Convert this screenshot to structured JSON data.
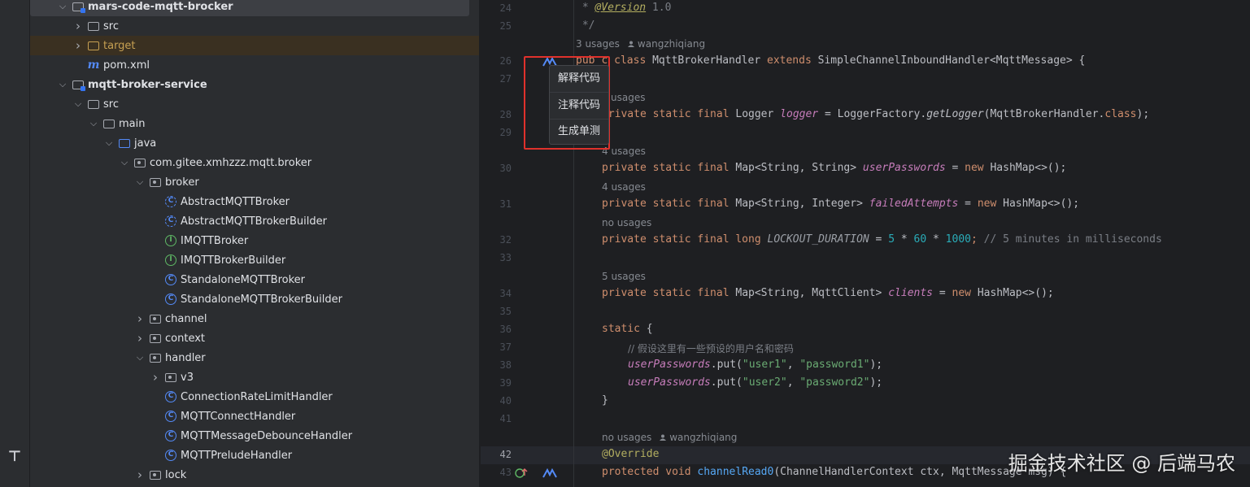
{
  "project_tree": {
    "rows": [
      {
        "label": "mars-code-mqtt-brocker",
        "depth": 2,
        "chevron": "down",
        "icon": "module-folder",
        "selected": true,
        "bold": true
      },
      {
        "label": "src",
        "depth": 3,
        "chevron": "right",
        "icon": "folder"
      },
      {
        "label": "target",
        "depth": 3,
        "chevron": "right",
        "icon": "excluded-folder",
        "excluded": true
      },
      {
        "label": "pom.xml",
        "depth": 3,
        "chevron": "none",
        "icon": "maven"
      },
      {
        "label": "mqtt-broker-service",
        "depth": 2,
        "chevron": "down",
        "icon": "module-folder",
        "bold": true
      },
      {
        "label": "src",
        "depth": 3,
        "chevron": "down",
        "icon": "folder"
      },
      {
        "label": "main",
        "depth": 4,
        "chevron": "down",
        "icon": "folder"
      },
      {
        "label": "java",
        "depth": 5,
        "chevron": "down",
        "icon": "source-root"
      },
      {
        "label": "com.gitee.xmhzzz.mqtt.broker",
        "depth": 6,
        "chevron": "down",
        "icon": "package"
      },
      {
        "label": "broker",
        "depth": 7,
        "chevron": "down",
        "icon": "package"
      },
      {
        "label": "AbstractMQTTBroker",
        "depth": 8,
        "chevron": "none",
        "icon": "abstract-class"
      },
      {
        "label": "AbstractMQTTBrokerBuilder",
        "depth": 8,
        "chevron": "none",
        "icon": "abstract-class"
      },
      {
        "label": "IMQTTBroker",
        "depth": 8,
        "chevron": "none",
        "icon": "interface"
      },
      {
        "label": "IMQTTBrokerBuilder",
        "depth": 8,
        "chevron": "none",
        "icon": "interface"
      },
      {
        "label": "StandaloneMQTTBroker",
        "depth": 8,
        "chevron": "none",
        "icon": "class"
      },
      {
        "label": "StandaloneMQTTBrokerBuilder",
        "depth": 8,
        "chevron": "none",
        "icon": "class"
      },
      {
        "label": "channel",
        "depth": 7,
        "chevron": "right",
        "icon": "package"
      },
      {
        "label": "context",
        "depth": 7,
        "chevron": "right",
        "icon": "package"
      },
      {
        "label": "handler",
        "depth": 7,
        "chevron": "down",
        "icon": "package"
      },
      {
        "label": "v3",
        "depth": 8,
        "chevron": "right",
        "icon": "package"
      },
      {
        "label": "ConnectionRateLimitHandler",
        "depth": 8,
        "chevron": "none",
        "icon": "class"
      },
      {
        "label": "MQTTConnectHandler",
        "depth": 8,
        "chevron": "none",
        "icon": "class"
      },
      {
        "label": "MQTTMessageDebounceHandler",
        "depth": 8,
        "chevron": "none",
        "icon": "class"
      },
      {
        "label": "MQTTPreludeHandler",
        "depth": 8,
        "chevron": "none",
        "icon": "class"
      },
      {
        "label": "lock",
        "depth": 7,
        "chevron": "right",
        "icon": "package"
      }
    ]
  },
  "editor": {
    "line_numbers": [
      "24",
      "25",
      "26",
      "27",
      "28",
      "29",
      "30",
      "31",
      "32",
      "33",
      "34",
      "35",
      "36",
      "37",
      "38",
      "39",
      "40",
      "41",
      "42",
      "43"
    ],
    "current_line": "42",
    "hints": {
      "class_usages": "3 usages",
      "class_author": "wangzhiqiang",
      "logger_usages": "usages",
      "userPasswords_usages": "4 usages",
      "failedAttempts_usages": "4 usages",
      "lockout_usages": "no usages",
      "clients_usages": "5 usages",
      "override_usages": "no usages",
      "override_author": "wangzhiqiang"
    },
    "code": {
      "l24_star": " * ",
      "l24_tag": "@Version",
      "l24_rest": " 1.0",
      "l25": " */",
      "l26_a": "pub",
      "l26_b": "c class ",
      "l26_name": "MqttBrokerHandler ",
      "l26_extends": "extends ",
      "l26_rest": "SimpleChannelInboundHandler<MqttMessage> {",
      "l28_kw": "private static final ",
      "l28_type": "Logger ",
      "l28_field": "logger",
      "l28_eq": " = LoggerFactory.",
      "l28_call": "getLogger",
      "l28_arg": "(MqttBrokerHandler.",
      "l28_cls": "class",
      "l28_end": ");",
      "l30_kw": "private static final ",
      "l30_type": "Map<String, String> ",
      "l30_field": "userPasswords",
      "l30_eq": " = ",
      "l30_new": "new ",
      "l30_end": "HashMap<>();",
      "l31_kw": "private static final ",
      "l31_type": "Map<String, Integer> ",
      "l31_field": "failedAttempts",
      "l31_eq": " = ",
      "l31_new": "new ",
      "l31_end": "HashMap<>();",
      "l32_kw": "private static final long ",
      "l32_field": "LOCKOUT_DURATION",
      "l32_eq": " = ",
      "l32_n1": "5",
      "l32_op1": " * ",
      "l32_n2": "60",
      "l32_op2": " * ",
      "l32_n3": "1000",
      "l32_semi": "; ",
      "l32_cmt": "// 5 minutes in milliseconds",
      "l34_kw": "private static final ",
      "l34_type": "Map<String, MqttClient> ",
      "l34_field": "clients",
      "l34_eq": " = ",
      "l34_new": "new ",
      "l34_end": "HashMap<>();",
      "l36_kw": "static ",
      "l36_brace": "{",
      "l37_cmt": "// 假设这里有一些预设的用户名和密码",
      "l38_field": "userPasswords",
      "l38_call": ".put(",
      "l38_s1": "\"user1\"",
      "l38_comma": ", ",
      "l38_s2": "\"password1\"",
      "l38_end": ");",
      "l39_field": "userPasswords",
      "l39_call": ".put(",
      "l39_s1": "\"user2\"",
      "l39_comma": ", ",
      "l39_s2": "\"password2\"",
      "l39_end": ");",
      "l40": "}",
      "l42_ann": "@Override",
      "l43_kw": "protected void ",
      "l43_method": "channelRead0",
      "l43_rest": "(ChannelHandlerContext ctx, MqttMessage msg) {"
    }
  },
  "context_menu": {
    "items": [
      "解释代码",
      "注释代码",
      "生成单测"
    ]
  },
  "watermark": "掘金技术社区 @ 后端马农",
  "colors": {
    "highlight_frame": "#e0312c",
    "keyword": "#cf8e6d",
    "field": "#c77dbb",
    "string": "#6aab73",
    "number": "#2aacb8",
    "comment": "#7a7e85",
    "annotation": "#b3ae60",
    "accent": "#548af7",
    "interface": "#5fb865"
  }
}
